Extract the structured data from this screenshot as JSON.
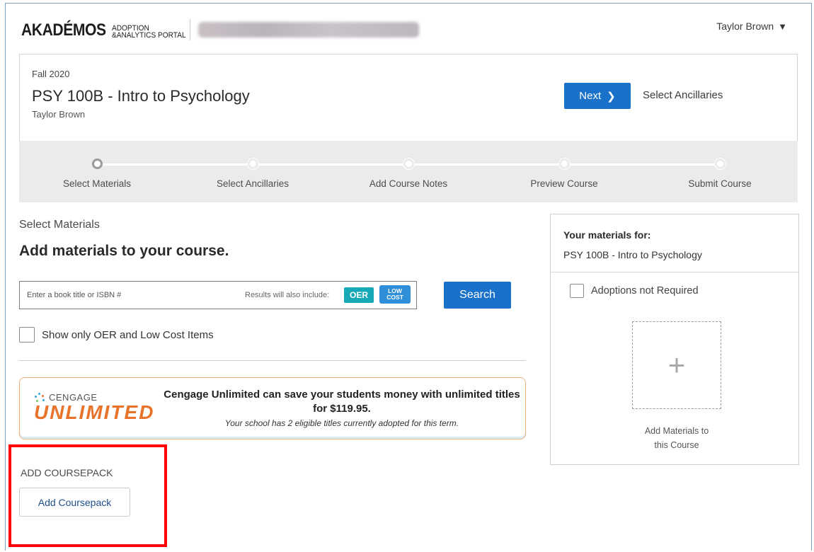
{
  "header": {
    "logo_main": "AKADÉMOS",
    "logo_sub_1": "ADOPTION",
    "logo_sub_2": "&ANALYTICS PORTAL",
    "user_name": "Taylor Brown",
    "user_caret": "▼"
  },
  "course": {
    "term": "Fall 2020",
    "title": "PSY 100B - Intro to Psychology",
    "instructor": "Taylor Brown",
    "next_button": "Next",
    "next_chevron": "❯",
    "next_step_label": "Select Ancillaries",
    "accent_color": "#1a71c9"
  },
  "stepper": {
    "steps": [
      {
        "label": "Select Materials",
        "active": true
      },
      {
        "label": "Select Ancillaries",
        "active": false
      },
      {
        "label": "Add Course Notes",
        "active": false
      },
      {
        "label": "Preview Course",
        "active": false
      },
      {
        "label": "Submit Course",
        "active": false
      }
    ]
  },
  "main": {
    "section_label": "Select Materials",
    "heading": "Add materials to your course.",
    "search": {
      "placeholder": "Enter a book title or ISBN #",
      "value": "",
      "results_note": "Results will also include:",
      "badge_oer": "OER",
      "badge_low_1": "LOW",
      "badge_low_2": "COST",
      "button": "Search"
    },
    "filter_checkbox_label": "Show only OER and Low Cost Items",
    "filter_checked": false,
    "promo": {
      "brand_top": "CENGAGE",
      "brand_main": "UNLIMITED",
      "headline": "Cengage Unlimited can save your students money with unlimited titles for $119.95.",
      "subtext": "Your school has 2 eligible titles currently adopted for this term.",
      "brand_color": "#e8732a"
    },
    "coursepack": {
      "label": "ADD COURSEPACK",
      "button": "Add Coursepack"
    }
  },
  "right_panel": {
    "title": "Your materials for:",
    "course": "PSY 100B - Intro to Psychology",
    "adoptions_label": "Adoptions not Required",
    "adoptions_checked": false,
    "add_icon": "+",
    "add_label_1": "Add Materials to",
    "add_label_2": "this Course"
  }
}
